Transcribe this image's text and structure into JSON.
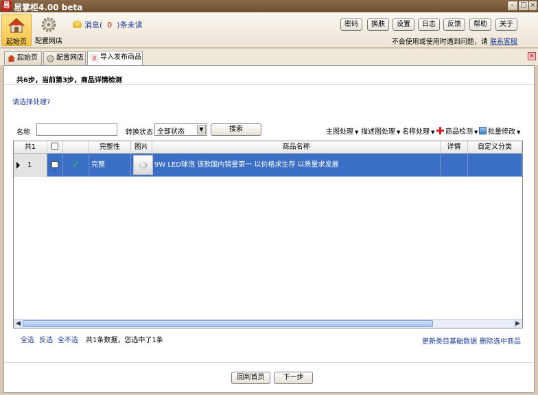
{
  "window": {
    "app_icon": "易",
    "title": "易掌柜4.00 beta",
    "minimize": "–",
    "maximize": "□",
    "close": "×"
  },
  "toolbar": {
    "home_label": "起始页",
    "config_label": "配置网店",
    "messages": {
      "prefix": "消息(",
      "count": "0",
      "suffix": ")条未读"
    },
    "buttons": [
      "密码",
      "换肤",
      "设置",
      "日志",
      "反馈",
      "帮助",
      "关于"
    ],
    "help_note": "不会使用或使用时遇到问题，请",
    "help_link": "联系客服"
  },
  "tabs": [
    {
      "label": "起始页",
      "icon": "home-icon"
    },
    {
      "label": "配置网店",
      "icon": "gear-icon"
    },
    {
      "label": "导入发布商品",
      "icon": "import-icon"
    }
  ],
  "tab_close": "×",
  "step": {
    "text": "共6步，当前第3步，商品详情检测"
  },
  "prompt": "请选择处理?",
  "filter": {
    "name_label": "名称",
    "name_value": "",
    "status_label": "转换状态",
    "status_selected": "全部状态",
    "search_label": "搜索",
    "menus": [
      "主图处理",
      "描述图处理",
      "名称处理",
      "商品检测",
      "批量修改"
    ]
  },
  "grid": {
    "headers": {
      "count": "共1",
      "complete": "完整性",
      "image": "图片",
      "name": "商品名称",
      "detail": "详情",
      "category": "自定义分类"
    },
    "rows": [
      {
        "index": "1",
        "checked": true,
        "status": "✓",
        "complete": "完整",
        "name": "9W LED球泡 该款国内销量第一  以价格求生存 以质量求发展"
      }
    ]
  },
  "selection": {
    "select_all": "全选",
    "invert": "反选",
    "select_none": "全不选",
    "count_text": "共1条数据，您选中了1条",
    "update_link": "更新类目基础数据",
    "delete_link": "删除选中商品"
  },
  "navigation": {
    "back_home": "回到首页",
    "next": "下一步"
  },
  "colors": {
    "selected_row": "#3b6fc5",
    "link": "#1a3a9a",
    "title_bar": "#7a5a3a"
  }
}
